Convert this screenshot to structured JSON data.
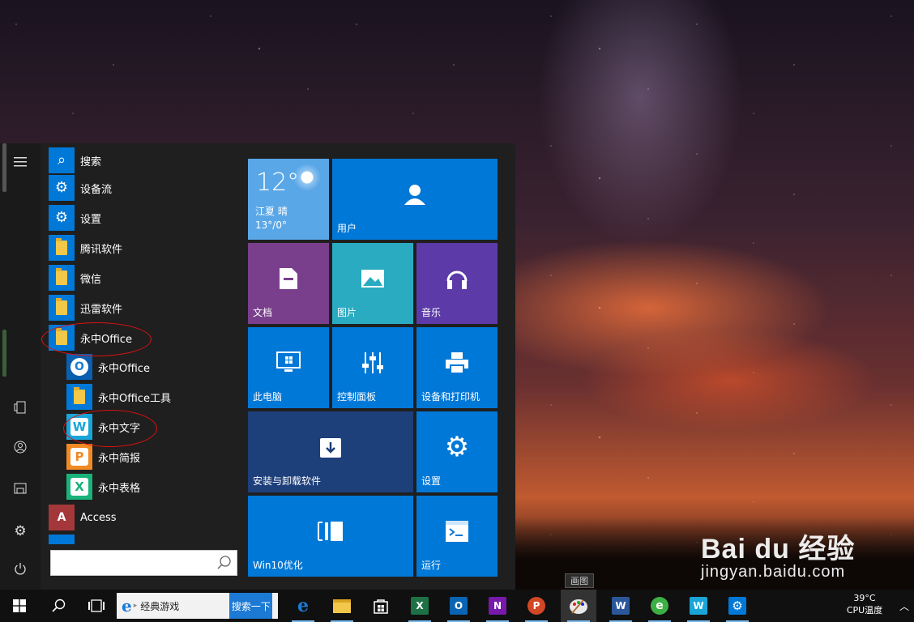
{
  "start_menu": {
    "apps": [
      {
        "label": "搜索",
        "icon": "search-icon",
        "kind": "blue"
      },
      {
        "label": "设备流",
        "icon": "gear-icon",
        "kind": "blue"
      },
      {
        "label": "设置",
        "icon": "gear-icon",
        "kind": "blue"
      },
      {
        "label": "腾讯软件",
        "icon": "folder-icon",
        "kind": "folder"
      },
      {
        "label": "微信",
        "icon": "folder-icon",
        "kind": "folder"
      },
      {
        "label": "迅雷软件",
        "icon": "folder-icon",
        "kind": "folder"
      },
      {
        "label": "永中Office",
        "icon": "folder-icon",
        "kind": "folder"
      }
    ],
    "sub_apps": [
      {
        "label": "永中Office",
        "icon": "yozo-office-icon",
        "letter": "O",
        "color": "#1a7fd4"
      },
      {
        "label": "永中Office工具",
        "icon": "folder-icon",
        "letter": "",
        "color": ""
      },
      {
        "label": "永中文字",
        "icon": "yozo-writer-icon",
        "letter": "W",
        "color": "#1aa5d8"
      },
      {
        "label": "永中简报",
        "icon": "yozo-presentation-icon",
        "letter": "P",
        "color": "#f08a24"
      },
      {
        "label": "永中表格",
        "icon": "yozo-spreadsheet-icon",
        "letter": "X",
        "color": "#19b37a"
      }
    ],
    "access": {
      "label": "Access",
      "letter": "A",
      "color": "#a4373a"
    },
    "search_placeholder": ""
  },
  "tiles": {
    "weather": {
      "temp": "12°",
      "city": "江夏  晴",
      "range": "13°/0°"
    },
    "user": "用户",
    "documents": "文档",
    "pictures": "图片",
    "music": "音乐",
    "this_pc": "此电脑",
    "control_panel": "控制面板",
    "devices_printers": "设备和打印机",
    "install_uninstall": "安装与卸载软件",
    "settings": "设置",
    "win10_optimize": "Win10优化",
    "run": "运行"
  },
  "taskbar": {
    "ie_search_text": "经典游戏",
    "ie_search_button": "搜索一下",
    "tooltip": "画图",
    "apps": [
      {
        "name": "edge-icon",
        "letter": "e",
        "color": "#1c7ad4"
      },
      {
        "name": "file-explorer-icon",
        "letter": "",
        "color": "#f3c84a"
      },
      {
        "name": "store-icon",
        "letter": "",
        "color": "#ffffff"
      },
      {
        "name": "excel-icon",
        "letter": "X",
        "color": "#1e7145"
      },
      {
        "name": "outlook-icon",
        "letter": "O",
        "color": "#0a64b4"
      },
      {
        "name": "onenote-icon",
        "letter": "N",
        "color": "#7719aa"
      },
      {
        "name": "powerpoint-icon",
        "letter": "P",
        "color": "#d24726"
      },
      {
        "name": "paint-icon",
        "letter": "",
        "color": "#e8e8e8"
      },
      {
        "name": "word-icon",
        "letter": "W",
        "color": "#2b579a"
      },
      {
        "name": "browser-green-icon",
        "letter": "e",
        "color": "#3cb043"
      },
      {
        "name": "yozo-writer-taskbar-icon",
        "letter": "W",
        "color": "#1aa5d8"
      },
      {
        "name": "settings-taskbar-icon",
        "letter": "⚙",
        "color": "#0078d7"
      }
    ]
  },
  "tray": {
    "temperature": "39°C",
    "cpu_label": "CPU温度"
  },
  "watermark": {
    "brand": "Bai du 经验",
    "url": "jingyan.baidu.com"
  },
  "colors": {
    "accent": "#0078d7",
    "annotation": "#dd1111"
  }
}
